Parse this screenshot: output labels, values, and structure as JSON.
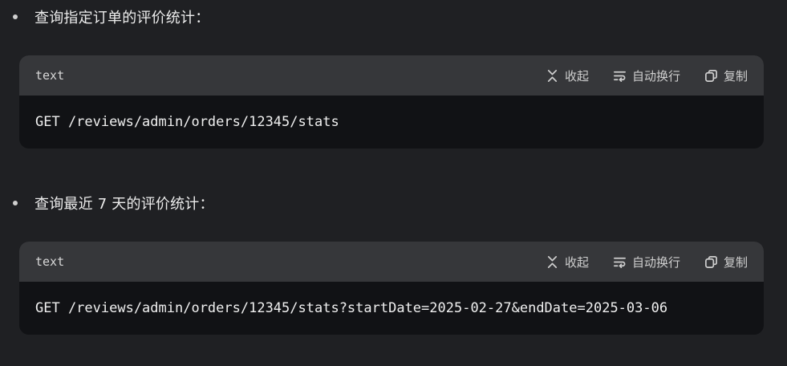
{
  "sections": [
    {
      "bullet": "查询指定订单的评价统计：",
      "code": {
        "language": "text",
        "content": "GET /reviews/admin/orders/12345/stats"
      }
    },
    {
      "bullet": "查询最近 7 天的评价统计：",
      "code": {
        "language": "text",
        "content": "GET /reviews/admin/orders/12345/stats?startDate=2025-02-27&endDate=2025-03-06"
      }
    }
  ],
  "actions": {
    "collapse": "收起",
    "wrap": "自动换行",
    "copy": "复制"
  },
  "icons": {
    "collapse": "collapse-icon",
    "wrap": "wrap-lines-icon",
    "copy": "copy-icon"
  },
  "colors": {
    "background": "#1f2023",
    "code_header": "#36373a",
    "code_body": "#111215"
  }
}
